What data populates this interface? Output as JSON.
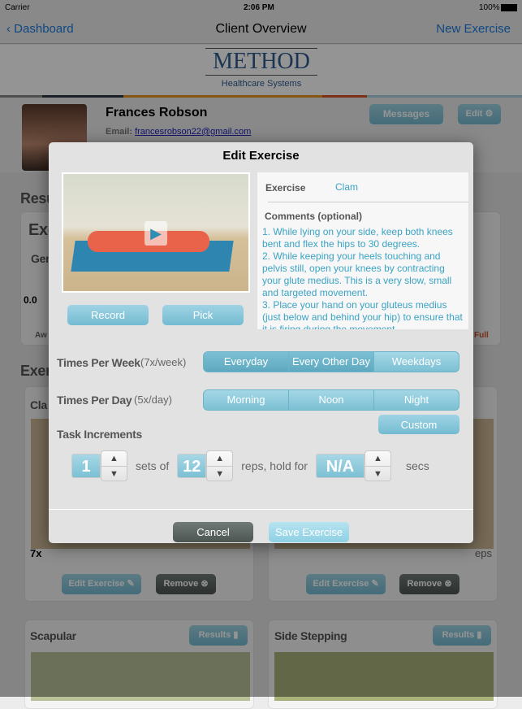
{
  "status": {
    "carrier": "Carrier",
    "time": "2:06 PM",
    "battery": "100%"
  },
  "nav": {
    "back": "Dashboard",
    "title": "Client Overview",
    "new_exercise": "New Exercise"
  },
  "logo": {
    "name": "METHOD",
    "sub": "Healthcare Systems"
  },
  "stripe_colors": [
    "#2e3a45",
    "#e8951f",
    "#d9542b",
    "#a9cfe0"
  ],
  "client": {
    "name": "Frances Robson",
    "email_label": "Email:",
    "email": "francesrobson22@gmail.com",
    "messages": "Messages",
    "edit": "Edit"
  },
  "background": {
    "results_heading": "Resu",
    "exercise_card_title": "Exe",
    "general_label": "Gen",
    "score": "0.0",
    "scale_low": "Aw",
    "scale_high": "Full",
    "exercises_heading": "Exer",
    "card1_title": "Cla",
    "card1_freq": "7x",
    "card1_reps": "eps",
    "edit_exercise": "Edit Exercise",
    "remove": "Remove",
    "card3_title": "Scapular",
    "card4_title": "Side Stepping",
    "results": "Results"
  },
  "modal": {
    "title": "Edit Exercise",
    "exercise_label": "Exercise",
    "exercise_value": "Clam",
    "comments_label": "Comments (optional)",
    "comments": "1. While lying on your side, keep both knees bent and flex the hips to 30 degrees.\n2. While keeping your heels touching and pelvis still, open your knees by contracting your glute medius. This is a very slow, small and targeted movement.\n3. Place your hand on your gluteus medius (just below and behind your hip) to ensure that it is firing during the movement.",
    "record": "Record",
    "pick": "Pick",
    "times_per_week": {
      "label": "Times Per Week",
      "value": "(7x/week)",
      "options": [
        "Everyday",
        "Every Other Day",
        "Weekdays"
      ],
      "selected": "Everyday"
    },
    "times_per_day": {
      "label": "Times Per Day",
      "value": "(5x/day)",
      "options": [
        "Morning",
        "Noon",
        "Night"
      ],
      "custom": "Custom"
    },
    "task_increments": {
      "label": "Task Increments",
      "sets": "1",
      "sets_text": "sets of",
      "reps": "12",
      "reps_text": "reps, hold for",
      "hold": "N/A",
      "hold_text": "secs"
    },
    "cancel": "Cancel",
    "save": "Save Exercise"
  }
}
